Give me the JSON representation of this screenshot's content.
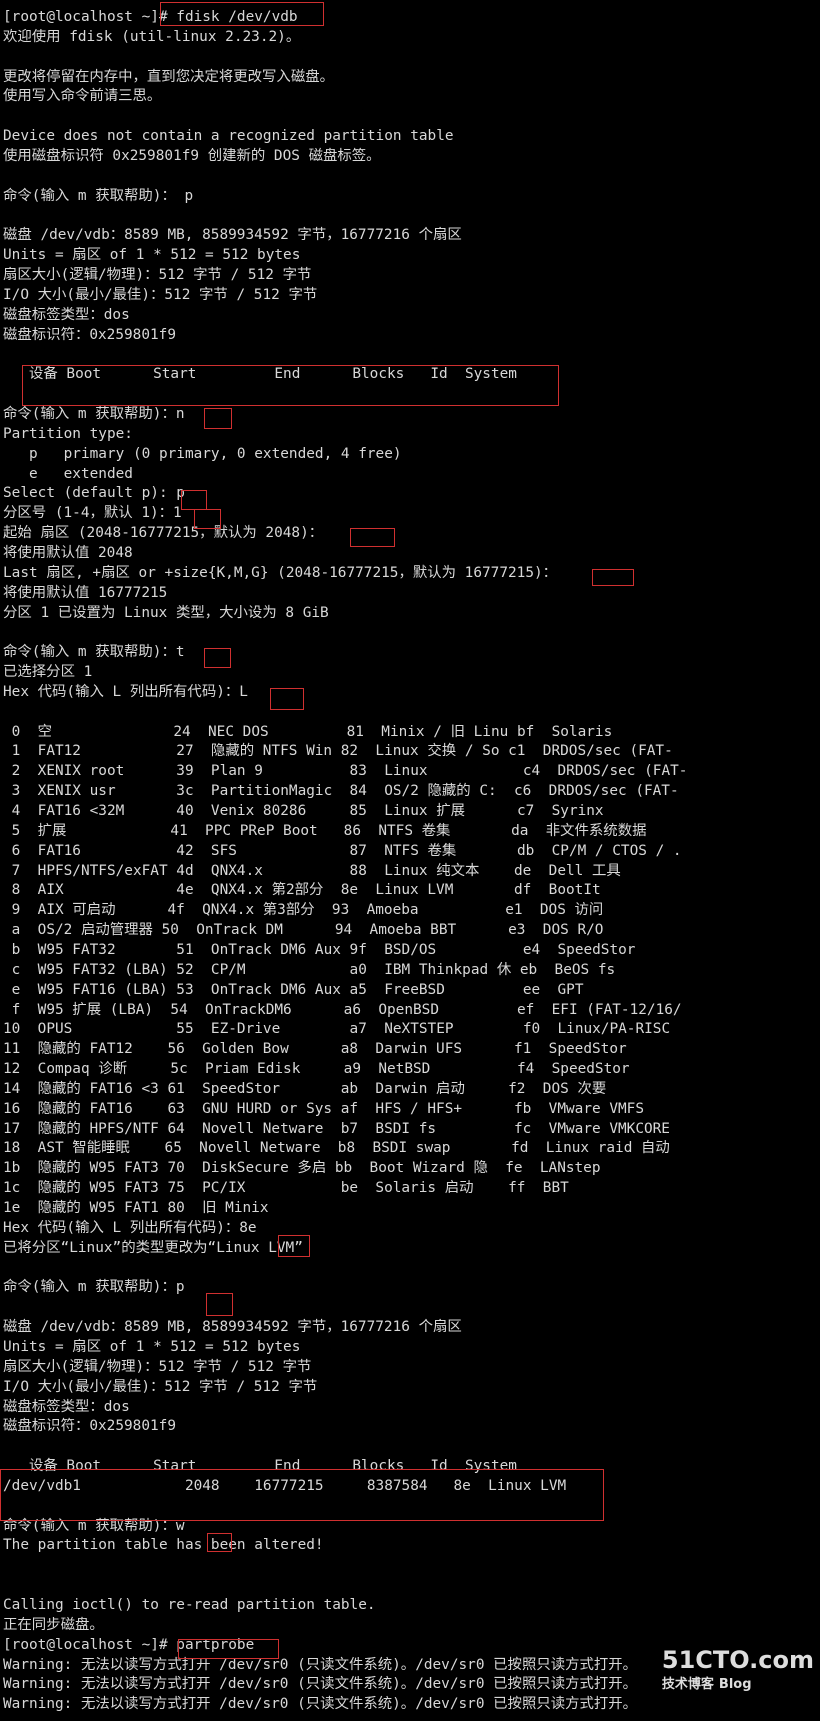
{
  "terminal": {
    "lines": [
      "[root@localhost ~]# fdisk /dev/vdb",
      "欢迎使用 fdisk (util-linux 2.23.2)。",
      "",
      "更改将停留在内存中，直到您决定将更改写入磁盘。",
      "使用写入命令前请三思。",
      "",
      "Device does not contain a recognized partition table",
      "使用磁盘标识符 0x259801f9 创建新的 DOS 磁盘标签。",
      "",
      "命令(输入 m 获取帮助)： p",
      "",
      "磁盘 /dev/vdb：8589 MB, 8589934592 字节，16777216 个扇区",
      "Units = 扇区 of 1 * 512 = 512 bytes",
      "扇区大小(逻辑/物理)：512 字节 / 512 字节",
      "I/O 大小(最小/最佳)：512 字节 / 512 字节",
      "磁盘标签类型：dos",
      "磁盘标识符：0x259801f9",
      "",
      "   设备 Boot      Start         End      Blocks   Id  System",
      "",
      "命令(输入 m 获取帮助)：n",
      "Partition type:",
      "   p   primary (0 primary, 0 extended, 4 free)",
      "   e   extended",
      "Select (default p): p",
      "分区号 (1-4，默认 1)：1",
      "起始 扇区 (2048-16777215，默认为 2048)：",
      "将使用默认值 2048",
      "Last 扇区, +扇区 or +size{K,M,G} (2048-16777215，默认为 16777215)：",
      "将使用默认值 16777215",
      "分区 1 已设置为 Linux 类型，大小设为 8 GiB",
      "",
      "命令(输入 m 获取帮助)：t",
      "已选择分区 1",
      "Hex 代码(输入 L 列出所有代码)：L",
      "",
      " 0  空              24  NEC DOS         81  Minix / 旧 Linu bf  Solaris",
      " 1  FAT12           27  隐藏的 NTFS Win 82  Linux 交换 / So c1  DRDOS/sec (FAT-",
      " 2  XENIX root      39  Plan 9          83  Linux           c4  DRDOS/sec (FAT-",
      " 3  XENIX usr       3c  PartitionMagic  84  OS/2 隐藏的 C:  c6  DRDOS/sec (FAT-",
      " 4  FAT16 <32M      40  Venix 80286     85  Linux 扩展      c7  Syrinx",
      " 5  扩展            41  PPC PReP Boot   86  NTFS 卷集       da  非文件系统数据",
      " 6  FAT16           42  SFS             87  NTFS 卷集       db  CP/M / CTOS / .",
      " 7  HPFS/NTFS/exFAT 4d  QNX4.x          88  Linux 纯文本    de  Dell 工具",
      " 8  AIX             4e  QNX4.x 第2部分  8e  Linux LVM       df  BootIt",
      " 9  AIX 可启动      4f  QNX4.x 第3部分  93  Amoeba          e1  DOS 访问",
      " a  OS/2 启动管理器 50  OnTrack DM      94  Amoeba BBT      e3  DOS R/O",
      " b  W95 FAT32       51  OnTrack DM6 Aux 9f  BSD/OS          e4  SpeedStor",
      " c  W95 FAT32 (LBA) 52  CP/M            a0  IBM Thinkpad 休 eb  BeOS fs",
      " e  W95 FAT16 (LBA) 53  OnTrack DM6 Aux a5  FreeBSD         ee  GPT",
      " f  W95 扩展 (LBA)  54  OnTrackDM6      a6  OpenBSD         ef  EFI (FAT-12/16/",
      "10  OPUS            55  EZ-Drive        a7  NeXTSTEP        f0  Linux/PA-RISC",
      "11  隐藏的 FAT12    56  Golden Bow      a8  Darwin UFS      f1  SpeedStor",
      "12  Compaq 诊断     5c  Priam Edisk     a9  NetBSD          f4  SpeedStor",
      "14  隐藏的 FAT16 <3 61  SpeedStor       ab  Darwin 启动     f2  DOS 次要",
      "16  隐藏的 FAT16    63  GNU HURD or Sys af  HFS / HFS+      fb  VMware VMFS",
      "17  隐藏的 HPFS/NTF 64  Novell Netware  b7  BSDI fs         fc  VMware VMKCORE",
      "18  AST 智能睡眠    65  Novell Netware  b8  BSDI swap       fd  Linux raid 自动",
      "1b  隐藏的 W95 FAT3 70  DiskSecure 多启 bb  Boot Wizard 隐  fe  LANstep",
      "1c  隐藏的 W95 FAT3 75  PC/IX           be  Solaris 启动    ff  BBT",
      "1e  隐藏的 W95 FAT1 80  旧 Minix",
      "Hex 代码(输入 L 列出所有代码)：8e",
      "已将分区“Linux”的类型更改为“Linux LVM”",
      "",
      "命令(输入 m 获取帮助)：p",
      "",
      "磁盘 /dev/vdb：8589 MB, 8589934592 字节，16777216 个扇区",
      "Units = 扇区 of 1 * 512 = 512 bytes",
      "扇区大小(逻辑/物理)：512 字节 / 512 字节",
      "I/O 大小(最小/最佳)：512 字节 / 512 字节",
      "磁盘标签类型：dos",
      "磁盘标识符：0x259801f9",
      "",
      "   设备 Boot      Start         End      Blocks   Id  System",
      "/dev/vdb1            2048    16777215     8387584   8e  Linux LVM",
      "",
      "命令(输入 m 获取帮助)：w",
      "The partition table has been altered!",
      "",
      "",
      "Calling ioctl() to re-read partition table.",
      "正在同步磁盘。",
      "[root@localhost ~]# partprobe",
      "Warning: 无法以读写方式打开 /dev/sr0 (只读文件系统)。/dev/sr0 已按照只读方式打开。",
      "Warning: 无法以读写方式打开 /dev/sr0 (只读文件系统)。/dev/sr0 已按照只读方式打开。",
      "Warning: 无法以读写方式打开 /dev/sr0 (只读文件系统)。/dev/sr0 已按照只读方式打开。"
    ]
  },
  "watermark": {
    "brand": "51CTO.com",
    "sub": "技术博客",
    "blog": "Blog"
  },
  "colors": {
    "background": "#000000",
    "text": "#d8d8d8",
    "highlight_box": "#d03030"
  }
}
